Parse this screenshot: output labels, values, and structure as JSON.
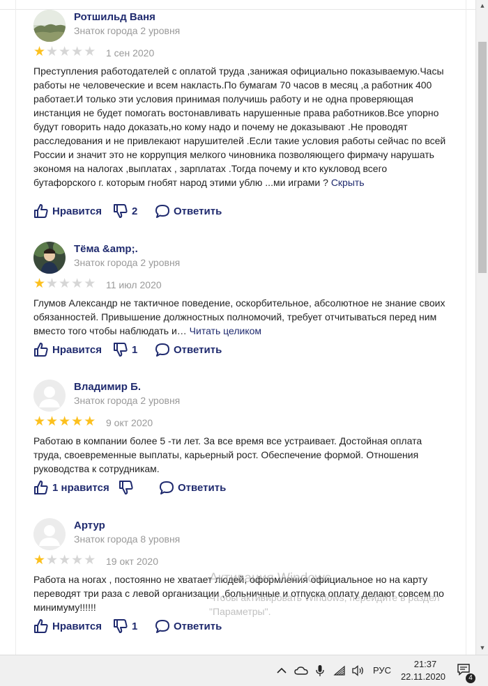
{
  "actions": {
    "like_label": "Нравится",
    "reply_label": "Ответить",
    "hide_label": "Скрыть",
    "read_more_label": "Читать целиком"
  },
  "reviews": [
    {
      "author": "Ротшильд Ваня",
      "level": "Знаток города 2 уровня",
      "rating": 1,
      "date": "1 сен 2020",
      "text": "Преступления работодателей с оплатой труда ,занижая официально показываемую.Часы работы не человеческие и всем накласть.По бумагам 70 часов в месяц ,а работник 400 работает.И только эти условия принимая получишь работу и не одна проверяющая инстанция не будет помогать востонавливать нарушенные права работников.Все упорно будут говорить надо доказать,но кому надо и почему не доказывают .Не проводят расследования и не привлекают нарушителей .Если такие условия работы сейчас по всей России и значит это не коррупция мелкого чиновника позволяющего фирмачу нарушать экономя на налогах ,выплатах , зарплатах .Тогда почему и кто кукловод всего бутафорского г. которым гнобят народ этими ублю ...ми играми ? ",
      "dislikes": "2"
    },
    {
      "author": "Тёма &amp;.",
      "level": "Знаток города 2 уровня",
      "rating": 1,
      "date": "11 июл 2020",
      "text": "Глумов Александр не тактичное поведение, оскорбительное, абсолютное не знание своих обязанностей. Привышение должностных полномочий, требует отчитываться перед ним вместо того чтобы наблюдать и… ",
      "dislikes": "1"
    },
    {
      "author": "Владимир Б.",
      "level": "Знаток города 2 уровня",
      "rating": 5,
      "date": "9 окт 2020",
      "text": "Работаю в компании более 5 -ти лет. За все время все устраивает. Достойная оплата труда, своевременные выплаты, карьерный рост. Обеспечение формой. Отношения руководства к сотрудникам.",
      "likes_label": "1 нравится"
    },
    {
      "author": "Артур",
      "level": "Знаток города 8 уровня",
      "rating": 1,
      "date": "19 окт 2020",
      "text": "Работа на ногах , постоянно не хватает людей, оформления официальное но на карту переводят три раза с левой организации ,больничные и отпуска оплату делают совсем по минимуму!!!!!!",
      "dislikes": "1"
    }
  ],
  "watermark": {
    "title": "Активация Windows",
    "subtitle": "Чтобы активировать Windows, перейдите в раздел \"Параметры\"."
  },
  "taskbar": {
    "language": "РУС",
    "time": "21:37",
    "date": "22.11.2020",
    "notifications": "4"
  },
  "colors": {
    "link": "#1f2a6e",
    "star_filled": "#fcc01e",
    "star_empty": "#d6d6d6",
    "muted": "#999999"
  }
}
